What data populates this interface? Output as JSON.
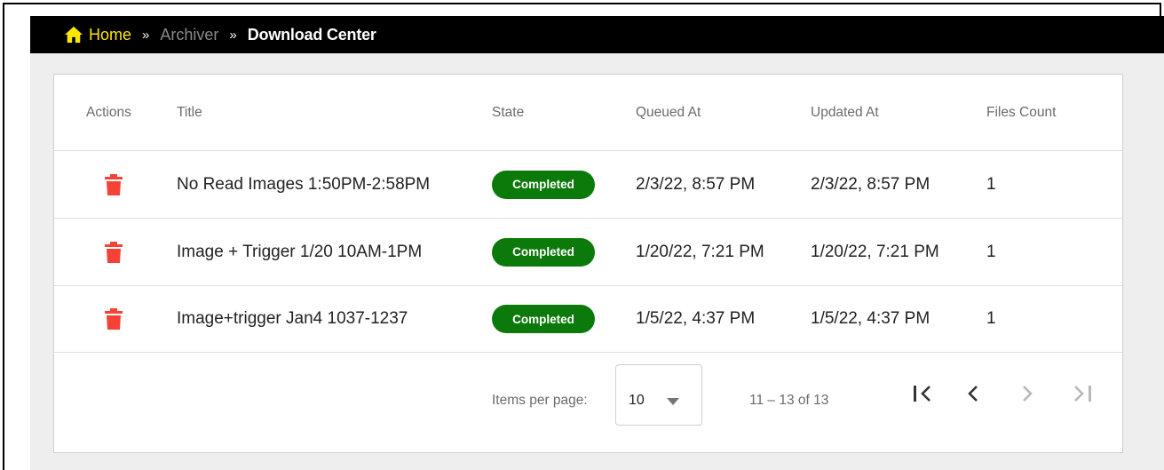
{
  "breadcrumb": {
    "home": "Home",
    "separator": "»",
    "middle": "Archiver",
    "current": "Download Center"
  },
  "table": {
    "headers": {
      "actions": "Actions",
      "title": "Title",
      "state": "State",
      "queued_at": "Queued At",
      "updated_at": "Updated At",
      "files_count": "Files Count"
    },
    "rows": [
      {
        "title": "No Read Images 1:50PM-2:58PM",
        "state": "Completed",
        "queued_at": "2/3/22, 8:57 PM",
        "updated_at": "2/3/22, 8:57 PM",
        "files_count": "1"
      },
      {
        "title": "Image + Trigger 1/20 10AM-1PM",
        "state": "Completed",
        "queued_at": "1/20/22, 7:21 PM",
        "updated_at": "1/20/22, 7:21 PM",
        "files_count": "1"
      },
      {
        "title": "Image+trigger Jan4 1037-1237",
        "state": "Completed",
        "queued_at": "1/5/22, 4:37 PM",
        "updated_at": "1/5/22, 4:37 PM",
        "files_count": "1"
      }
    ]
  },
  "paginator": {
    "items_per_page_label": "Items per page:",
    "items_per_page_value": "10",
    "range_label": "11 – 13 of 13"
  },
  "icons": {
    "home": "home-icon",
    "delete": "trash-icon",
    "dropdown": "caret-down-icon",
    "first": "first-page-icon",
    "prev": "chevron-left-icon",
    "next": "chevron-right-icon",
    "last": "last-page-icon"
  },
  "colors": {
    "topbar_bg": "#000000",
    "home_link": "#ffe600",
    "trash": "#f44336",
    "badge_bg": "#0b7a0b",
    "canvas_bg": "#eeeeee"
  }
}
